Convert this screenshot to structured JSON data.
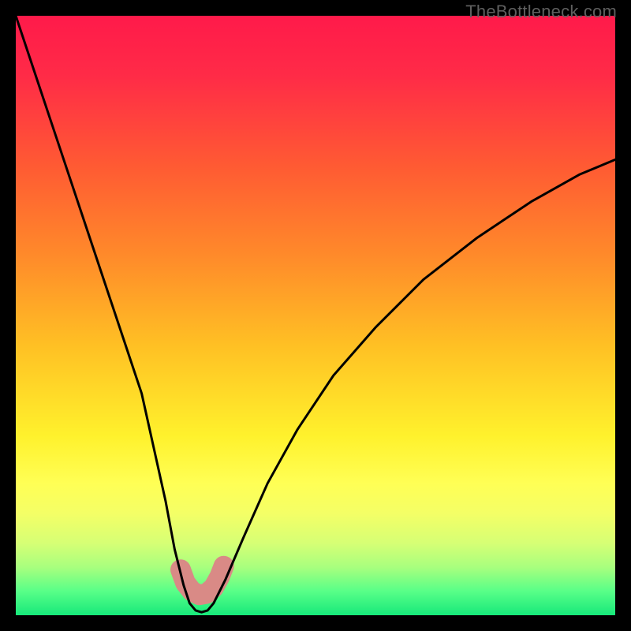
{
  "watermark": "TheBottleneck.com",
  "gradient_stops": [
    {
      "pct": 0,
      "color": "#ff1a4a"
    },
    {
      "pct": 10,
      "color": "#ff2b47"
    },
    {
      "pct": 25,
      "color": "#ff5a33"
    },
    {
      "pct": 40,
      "color": "#ff8a2a"
    },
    {
      "pct": 55,
      "color": "#ffc024"
    },
    {
      "pct": 70,
      "color": "#fff12c"
    },
    {
      "pct": 78,
      "color": "#ffff55"
    },
    {
      "pct": 83,
      "color": "#f4ff66"
    },
    {
      "pct": 88,
      "color": "#d6ff75"
    },
    {
      "pct": 92,
      "color": "#a8ff7e"
    },
    {
      "pct": 96,
      "color": "#58ff88"
    },
    {
      "pct": 100,
      "color": "#17e87a"
    }
  ],
  "chart_data": {
    "type": "line",
    "title": "",
    "xlabel": "",
    "ylabel": "",
    "xlim": [
      0,
      100
    ],
    "ylim": [
      0,
      100
    ],
    "series": [
      {
        "name": "bottleneck-curve",
        "x": [
          0,
          3,
          6,
          9,
          12,
          15,
          18,
          21,
          23,
          25,
          26.5,
          28,
          29,
          30,
          31,
          32,
          33,
          35,
          38,
          42,
          47,
          53,
          60,
          68,
          77,
          86,
          94,
          100
        ],
        "y": [
          100,
          91,
          82,
          73,
          64,
          55,
          46,
          37,
          28,
          19,
          11,
          5,
          2,
          0.8,
          0.5,
          0.8,
          2,
          6,
          13,
          22,
          31,
          40,
          48,
          56,
          63,
          69,
          73.5,
          76
        ]
      }
    ],
    "highlight_band": {
      "name": "optimal-zone-marker",
      "color": "#d98a86",
      "points_norm": [
        [
          0.275,
          0.924
        ],
        [
          0.283,
          0.946
        ],
        [
          0.294,
          0.96
        ],
        [
          0.306,
          0.966
        ],
        [
          0.318,
          0.964
        ],
        [
          0.33,
          0.954
        ],
        [
          0.34,
          0.936
        ],
        [
          0.347,
          0.918
        ]
      ],
      "stroke_width": 26
    }
  }
}
